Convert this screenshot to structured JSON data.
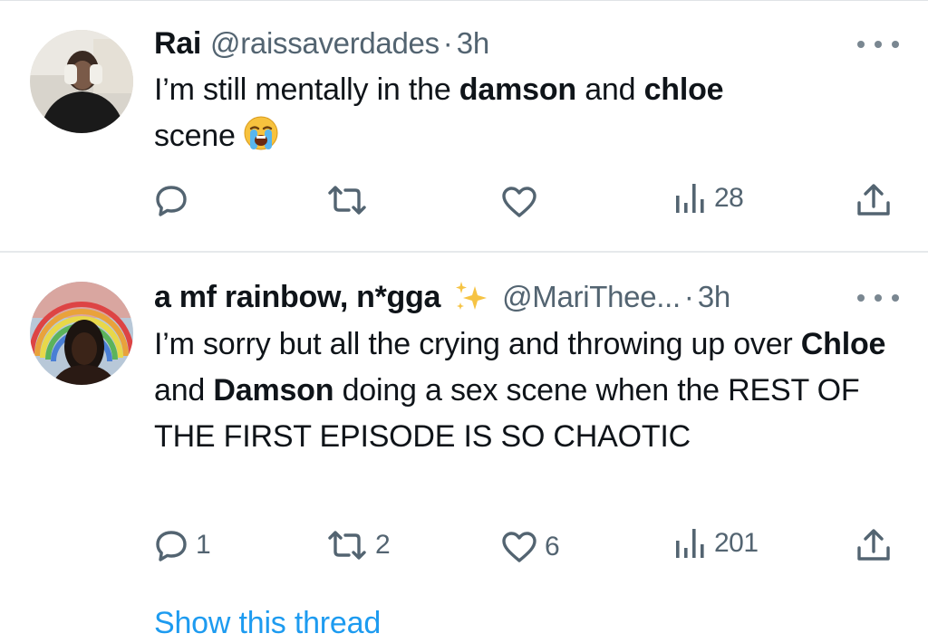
{
  "tweets": [
    {
      "name": "Rai",
      "handle": "@raissaverdades",
      "separator": "·",
      "time": "3h",
      "text_parts": [
        "I’m still mentally in the ",
        "damson",
        " and ",
        "chloe",
        " scene"
      ],
      "emoji": "loudly-crying-face-emoji",
      "actions": {
        "replies": "",
        "retweets": "",
        "likes": "",
        "views": "28"
      }
    },
    {
      "name": "a mf rainbow, n*gga",
      "badge_icon": "sparkles-emoji",
      "handle": "@MariThee...",
      "separator": "·",
      "time": "3h",
      "text_parts": [
        "I’m sorry but all the crying and throwing up over ",
        "Chloe",
        " and ",
        "Damson",
        " doing a sex scene when the REST OF THE FIRST EPISODE IS SO CHAOTIC"
      ],
      "actions": {
        "replies": "1",
        "retweets": "2",
        "likes": "6",
        "views": "201"
      }
    }
  ],
  "show_thread": "Show this thread",
  "colors": {
    "accent": "#1d9bf0",
    "secondary_text": "#536471",
    "text": "#0f1419"
  }
}
